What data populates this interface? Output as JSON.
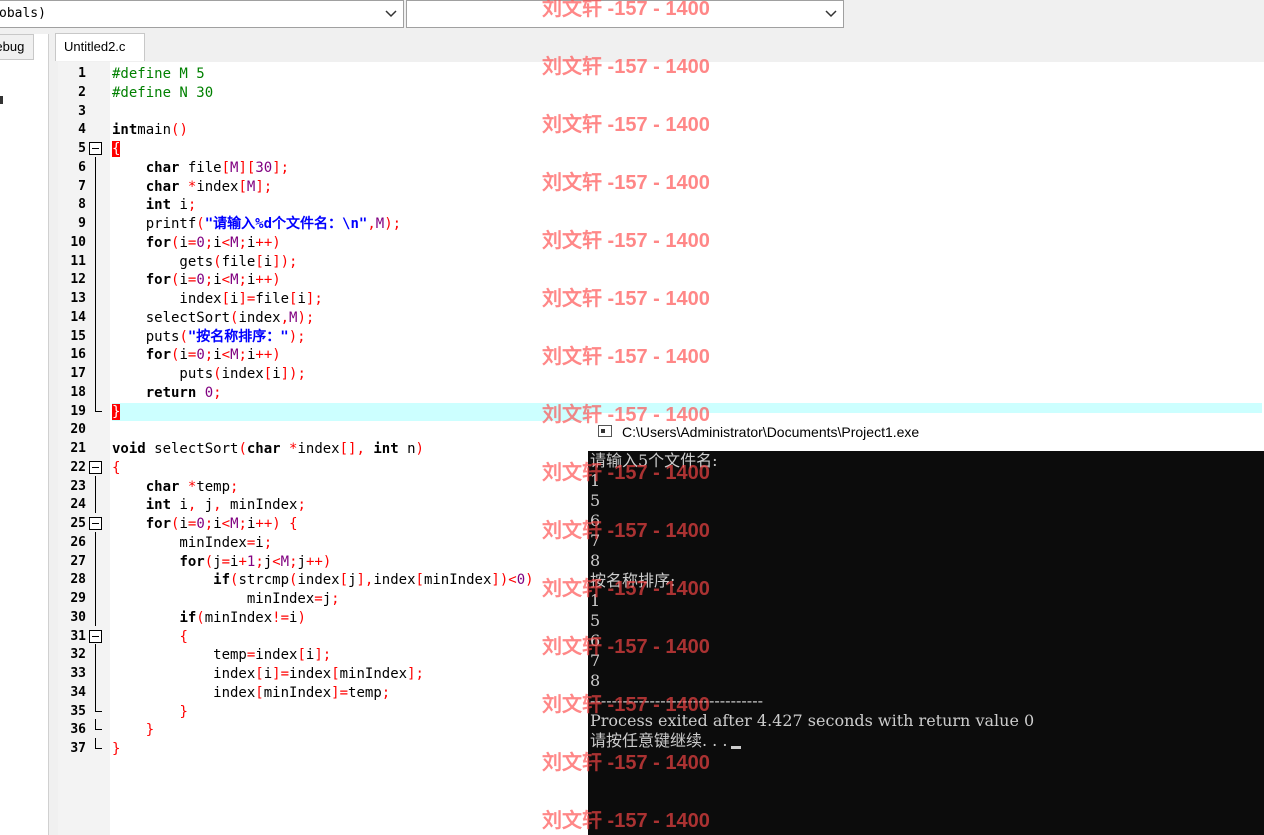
{
  "toolbar": {
    "scope_combo_value": "obals)",
    "function_combo_value": ""
  },
  "left_panel": {
    "debug_tab_label": "Debug"
  },
  "editor": {
    "file_tab_label": "Untitled2.c",
    "highlighted_line": 19,
    "lines": [
      {
        "n": "1",
        "segs": [
          [
            "pp",
            "#define M 5"
          ]
        ]
      },
      {
        "n": "2",
        "segs": [
          [
            "pp",
            "#define N 30"
          ]
        ]
      },
      {
        "n": "3",
        "segs": []
      },
      {
        "n": "4",
        "segs": [
          [
            "kw",
            "int"
          ],
          [
            "",
            "main"
          ],
          [
            "sy",
            "()"
          ]
        ]
      },
      {
        "n": "5",
        "fold": "box",
        "segs": [
          [
            "bracehl",
            "{"
          ]
        ]
      },
      {
        "n": "6",
        "fold": "vline",
        "segs": [
          [
            "",
            "    "
          ],
          [
            "kw",
            "char"
          ],
          [
            "",
            " file"
          ],
          [
            "sy",
            "["
          ],
          [
            "nm",
            "M"
          ],
          [
            "sy",
            "]["
          ],
          [
            "nm",
            "30"
          ],
          [
            "sy",
            "];"
          ]
        ]
      },
      {
        "n": "7",
        "fold": "vline",
        "segs": [
          [
            "",
            "    "
          ],
          [
            "kw",
            "char"
          ],
          [
            "",
            " "
          ],
          [
            "sy",
            "*"
          ],
          [
            "",
            "index"
          ],
          [
            "sy",
            "["
          ],
          [
            "nm",
            "M"
          ],
          [
            "sy",
            "];"
          ]
        ]
      },
      {
        "n": "8",
        "fold": "vline",
        "segs": [
          [
            "",
            "    "
          ],
          [
            "kw",
            "int"
          ],
          [
            "",
            " i"
          ],
          [
            "sy",
            ";"
          ]
        ]
      },
      {
        "n": "9",
        "fold": "vline",
        "segs": [
          [
            "",
            "    printf"
          ],
          [
            "sy",
            "("
          ],
          [
            "st",
            "\"请输入%d个文件名：\\n\""
          ],
          [
            "sy",
            ","
          ],
          [
            "nm",
            "M"
          ],
          [
            "sy",
            ");"
          ]
        ]
      },
      {
        "n": "10",
        "fold": "vline",
        "segs": [
          [
            "",
            "    "
          ],
          [
            "kw",
            "for"
          ],
          [
            "sy",
            "("
          ],
          [
            "",
            "i"
          ],
          [
            "sy",
            "="
          ],
          [
            "nm",
            "0"
          ],
          [
            "sy",
            ";"
          ],
          [
            "",
            "i"
          ],
          [
            "sy",
            "<"
          ],
          [
            "nm",
            "M"
          ],
          [
            "sy",
            ";"
          ],
          [
            "",
            "i"
          ],
          [
            "sy",
            "++)"
          ]
        ]
      },
      {
        "n": "11",
        "fold": "vline",
        "segs": [
          [
            "",
            "        gets"
          ],
          [
            "sy",
            "("
          ],
          [
            "",
            "file"
          ],
          [
            "sy",
            "["
          ],
          [
            "",
            "i"
          ],
          [
            "sy",
            "]);"
          ]
        ]
      },
      {
        "n": "12",
        "fold": "vline",
        "segs": [
          [
            "",
            "    "
          ],
          [
            "kw",
            "for"
          ],
          [
            "sy",
            "("
          ],
          [
            "",
            "i"
          ],
          [
            "sy",
            "="
          ],
          [
            "nm",
            "0"
          ],
          [
            "sy",
            ";"
          ],
          [
            "",
            "i"
          ],
          [
            "sy",
            "<"
          ],
          [
            "nm",
            "M"
          ],
          [
            "sy",
            ";"
          ],
          [
            "",
            "i"
          ],
          [
            "sy",
            "++)"
          ]
        ]
      },
      {
        "n": "13",
        "fold": "vline",
        "segs": [
          [
            "",
            "        index"
          ],
          [
            "sy",
            "["
          ],
          [
            "",
            "i"
          ],
          [
            "sy",
            "]="
          ],
          [
            "",
            "file"
          ],
          [
            "sy",
            "["
          ],
          [
            "",
            "i"
          ],
          [
            "sy",
            "];"
          ]
        ]
      },
      {
        "n": "14",
        "fold": "vline",
        "segs": [
          [
            "",
            "    selectSort"
          ],
          [
            "sy",
            "("
          ],
          [
            "",
            "index"
          ],
          [
            "sy",
            ","
          ],
          [
            "nm",
            "M"
          ],
          [
            "sy",
            ");"
          ]
        ]
      },
      {
        "n": "15",
        "fold": "vline",
        "segs": [
          [
            "",
            "    puts"
          ],
          [
            "sy",
            "("
          ],
          [
            "st",
            "\"按名称排序：\""
          ],
          [
            "sy",
            ");"
          ]
        ]
      },
      {
        "n": "16",
        "fold": "vline",
        "segs": [
          [
            "",
            "    "
          ],
          [
            "kw",
            "for"
          ],
          [
            "sy",
            "("
          ],
          [
            "",
            "i"
          ],
          [
            "sy",
            "="
          ],
          [
            "nm",
            "0"
          ],
          [
            "sy",
            ";"
          ],
          [
            "",
            "i"
          ],
          [
            "sy",
            "<"
          ],
          [
            "nm",
            "M"
          ],
          [
            "sy",
            ";"
          ],
          [
            "",
            "i"
          ],
          [
            "sy",
            "++)"
          ]
        ]
      },
      {
        "n": "17",
        "fold": "vline",
        "segs": [
          [
            "",
            "        puts"
          ],
          [
            "sy",
            "("
          ],
          [
            "",
            "index"
          ],
          [
            "sy",
            "["
          ],
          [
            "",
            "i"
          ],
          [
            "sy",
            "]);"
          ]
        ]
      },
      {
        "n": "18",
        "fold": "vline",
        "segs": [
          [
            "",
            "    "
          ],
          [
            "kw",
            "return"
          ],
          [
            "",
            " "
          ],
          [
            "nm",
            "0"
          ],
          [
            "sy",
            ";"
          ]
        ]
      },
      {
        "n": "19",
        "fold": "end",
        "segs": [
          [
            "bracehl",
            "}"
          ]
        ]
      },
      {
        "n": "20",
        "segs": []
      },
      {
        "n": "21",
        "segs": [
          [
            "kw",
            "void"
          ],
          [
            "",
            " selectSort"
          ],
          [
            "sy",
            "("
          ],
          [
            "kw",
            "char"
          ],
          [
            "",
            " "
          ],
          [
            "sy",
            "*"
          ],
          [
            "",
            "index"
          ],
          [
            "sy",
            "[],"
          ],
          [
            "",
            " "
          ],
          [
            "kw",
            "int"
          ],
          [
            "",
            " n"
          ],
          [
            "sy",
            ")"
          ]
        ]
      },
      {
        "n": "22",
        "fold": "box",
        "segs": [
          [
            "sy",
            "{"
          ]
        ]
      },
      {
        "n": "23",
        "fold": "vline",
        "segs": [
          [
            "",
            "    "
          ],
          [
            "kw",
            "char"
          ],
          [
            "",
            " "
          ],
          [
            "sy",
            "*"
          ],
          [
            "",
            "temp"
          ],
          [
            "sy",
            ";"
          ]
        ]
      },
      {
        "n": "24",
        "fold": "vline",
        "segs": [
          [
            "",
            "    "
          ],
          [
            "kw",
            "int"
          ],
          [
            "",
            " i"
          ],
          [
            "sy",
            ","
          ],
          [
            "",
            " j"
          ],
          [
            "sy",
            ","
          ],
          [
            "",
            " minIndex"
          ],
          [
            "sy",
            ";"
          ]
        ]
      },
      {
        "n": "25",
        "fold": "box",
        "segs": [
          [
            "",
            "    "
          ],
          [
            "kw",
            "for"
          ],
          [
            "sy",
            "("
          ],
          [
            "",
            "i"
          ],
          [
            "sy",
            "="
          ],
          [
            "nm",
            "0"
          ],
          [
            "sy",
            ";"
          ],
          [
            "",
            "i"
          ],
          [
            "sy",
            "<"
          ],
          [
            "nm",
            "M"
          ],
          [
            "sy",
            ";"
          ],
          [
            "",
            "i"
          ],
          [
            "sy",
            "++)"
          ],
          [
            "",
            " "
          ],
          [
            "sy",
            "{"
          ]
        ]
      },
      {
        "n": "26",
        "fold": "vline",
        "segs": [
          [
            "",
            "        minIndex"
          ],
          [
            "sy",
            "="
          ],
          [
            "",
            "i"
          ],
          [
            "sy",
            ";"
          ]
        ]
      },
      {
        "n": "27",
        "fold": "vline",
        "segs": [
          [
            "",
            "        "
          ],
          [
            "kw",
            "for"
          ],
          [
            "sy",
            "("
          ],
          [
            "",
            "j"
          ],
          [
            "sy",
            "="
          ],
          [
            "",
            "i"
          ],
          [
            "sy",
            "+"
          ],
          [
            "nm",
            "1"
          ],
          [
            "sy",
            ";"
          ],
          [
            "",
            "j"
          ],
          [
            "sy",
            "<"
          ],
          [
            "nm",
            "M"
          ],
          [
            "sy",
            ";"
          ],
          [
            "",
            "j"
          ],
          [
            "sy",
            "++)"
          ]
        ]
      },
      {
        "n": "28",
        "fold": "vline",
        "segs": [
          [
            "",
            "            "
          ],
          [
            "kw",
            "if"
          ],
          [
            "sy",
            "("
          ],
          [
            "",
            "strcmp"
          ],
          [
            "sy",
            "("
          ],
          [
            "",
            "index"
          ],
          [
            "sy",
            "["
          ],
          [
            "",
            "j"
          ],
          [
            "sy",
            "],"
          ],
          [
            "",
            "index"
          ],
          [
            "sy",
            "["
          ],
          [
            "",
            "minIndex"
          ],
          [
            "sy",
            "])<"
          ],
          [
            "nm",
            "0"
          ],
          [
            "sy",
            ")"
          ]
        ]
      },
      {
        "n": "29",
        "fold": "vline",
        "segs": [
          [
            "",
            "                minIndex"
          ],
          [
            "sy",
            "="
          ],
          [
            "",
            "j"
          ],
          [
            "sy",
            ";"
          ]
        ]
      },
      {
        "n": "30",
        "fold": "vline",
        "segs": [
          [
            "",
            "        "
          ],
          [
            "kw",
            "if"
          ],
          [
            "sy",
            "("
          ],
          [
            "",
            "minIndex"
          ],
          [
            "sy",
            "!="
          ],
          [
            "",
            "i"
          ],
          [
            "sy",
            ")"
          ]
        ]
      },
      {
        "n": "31",
        "fold": "box",
        "segs": [
          [
            "",
            "        "
          ],
          [
            "sy",
            "{"
          ]
        ]
      },
      {
        "n": "32",
        "fold": "vline",
        "segs": [
          [
            "",
            "            temp"
          ],
          [
            "sy",
            "="
          ],
          [
            "",
            "index"
          ],
          [
            "sy",
            "["
          ],
          [
            "",
            "i"
          ],
          [
            "sy",
            "];"
          ]
        ]
      },
      {
        "n": "33",
        "fold": "vline",
        "segs": [
          [
            "",
            "            index"
          ],
          [
            "sy",
            "["
          ],
          [
            "",
            "i"
          ],
          [
            "sy",
            "]="
          ],
          [
            "",
            "index"
          ],
          [
            "sy",
            "["
          ],
          [
            "",
            "minIndex"
          ],
          [
            "sy",
            "];"
          ]
        ]
      },
      {
        "n": "34",
        "fold": "vline",
        "segs": [
          [
            "",
            "            index"
          ],
          [
            "sy",
            "["
          ],
          [
            "",
            "minIndex"
          ],
          [
            "sy",
            "]="
          ],
          [
            "",
            "temp"
          ],
          [
            "sy",
            ";"
          ]
        ]
      },
      {
        "n": "35",
        "fold": "end",
        "segs": [
          [
            "",
            "        "
          ],
          [
            "sy",
            "}"
          ]
        ]
      },
      {
        "n": "36",
        "fold": "end",
        "segs": [
          [
            "",
            "    "
          ],
          [
            "sy",
            "}"
          ]
        ]
      },
      {
        "n": "37",
        "fold": "end",
        "segs": [
          [
            "sy",
            "}"
          ]
        ]
      }
    ]
  },
  "console": {
    "title": "C:\\Users\\Administrator\\Documents\\Project1.exe",
    "lines": [
      "请输入5个文件名:",
      "1",
      "5",
      "6",
      "7",
      "8",
      "按名称排序:",
      "1",
      "5",
      "6",
      "7",
      "8",
      "--------------------------------",
      "Process exited after 4.427 seconds with return value 0",
      "请按任意键继续. . ."
    ]
  },
  "watermark": {
    "text": "刘文轩 -157 - 1400"
  },
  "colors": {
    "preprocessor": "#008000",
    "symbol": "#ff0000",
    "string": "#0000ff",
    "number": "#800080",
    "current_line": "#ccffff",
    "watermark": "#ff4646"
  }
}
